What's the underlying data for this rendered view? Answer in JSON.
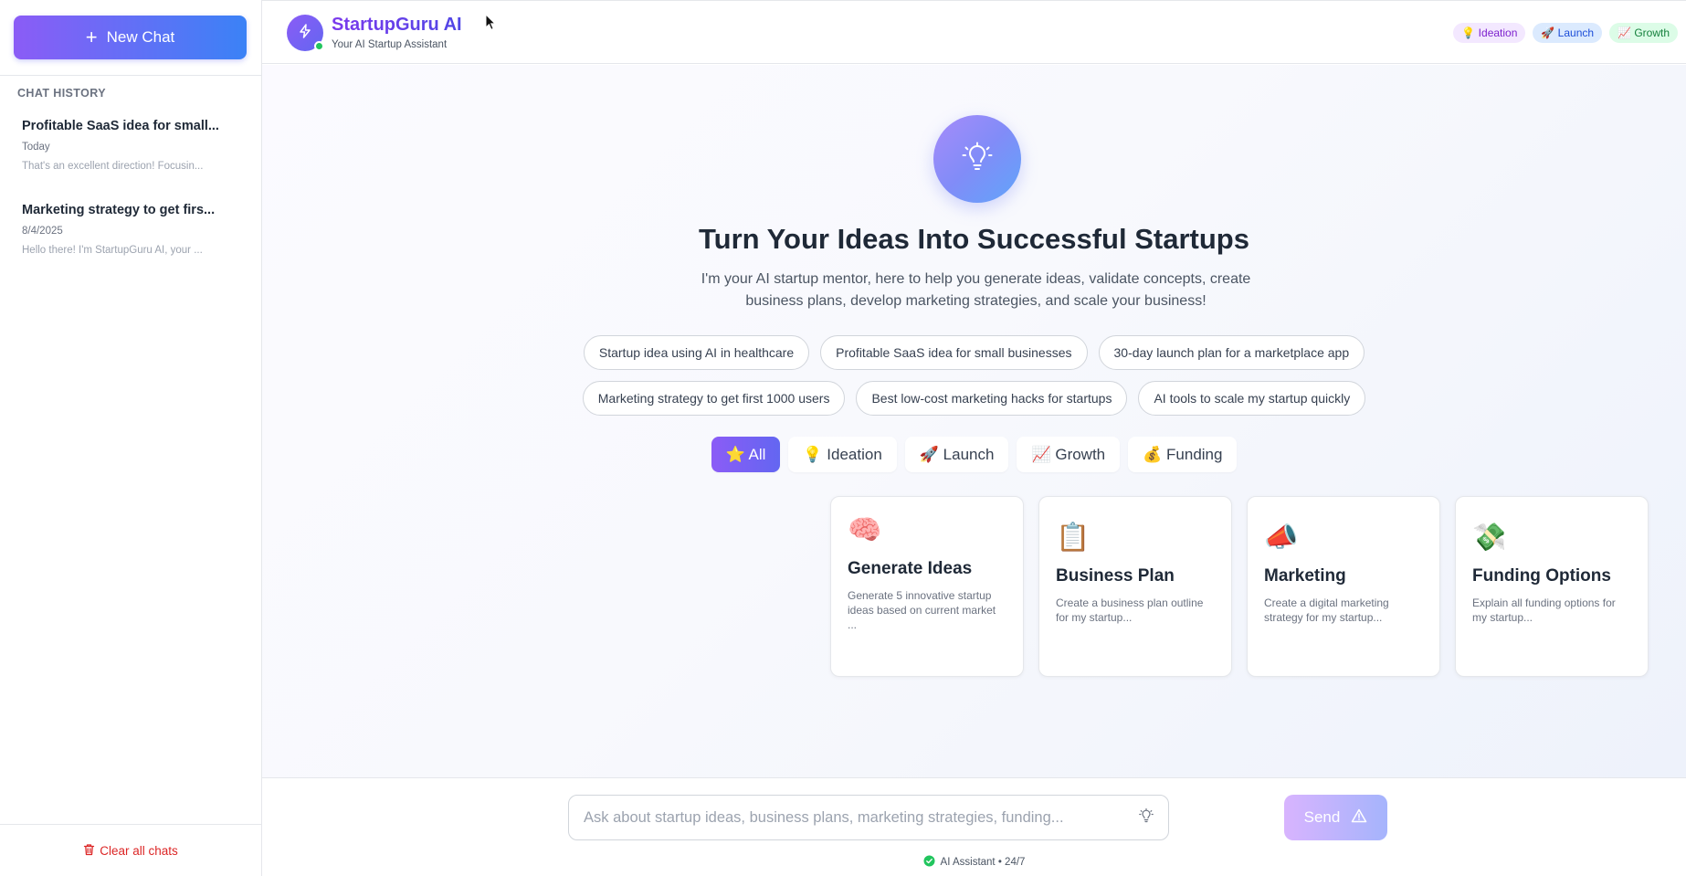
{
  "sidebar": {
    "new_chat_label": "New Chat",
    "history_title": "CHAT HISTORY",
    "history": [
      {
        "title": "Profitable SaaS idea for small...",
        "date": "Today",
        "preview": "That's an excellent direction! Focusin..."
      },
      {
        "title": "Marketing strategy to get firs...",
        "date": "8/4/2025",
        "preview": "Hello there! I'm StartupGuru AI, your ..."
      }
    ],
    "clear_label": "Clear all chats"
  },
  "header": {
    "app_name": "StartupGuru AI",
    "app_subtitle": "Your AI Startup Assistant",
    "tags": [
      "💡 Ideation",
      "🚀 Launch",
      "📈 Growth"
    ]
  },
  "hero": {
    "title": "Turn Your Ideas Into Successful Startups",
    "subtitle": "I'm your AI startup mentor, here to help you generate ideas, validate concepts, create business plans, develop marketing strategies, and scale your business!"
  },
  "prompts": [
    "Startup idea using AI in healthcare",
    "Profitable SaaS idea for small businesses",
    "30-day launch plan for a marketplace app",
    "Marketing strategy to get first 1000 users",
    "Best low-cost marketing hacks for startups",
    "AI tools to scale my startup quickly"
  ],
  "filters": [
    "⭐ All",
    "💡 Ideation",
    "🚀 Launch",
    "📈 Growth",
    "💰 Funding"
  ],
  "active_filter": "⭐ All",
  "cards": [
    {
      "icon": "🧠",
      "title": "Generate Ideas",
      "desc": "Generate 5 innovative startup ideas based on current market ..."
    },
    {
      "icon": "📋",
      "title": "Business Plan",
      "desc": "Create a business plan outline for my startup..."
    },
    {
      "icon": "📣",
      "title": "Marketing",
      "desc": "Create a digital marketing strategy for my startup..."
    },
    {
      "icon": "💸",
      "title": "Funding Options",
      "desc": "Explain all funding options for my startup..."
    }
  ],
  "input": {
    "placeholder": "Ask about startup ideas, business plans, marketing strategies, funding...",
    "value": "",
    "send_label": "Send",
    "status": "AI Assistant • 24/7"
  },
  "colors": {
    "accent_purple": "#8b5cf6",
    "accent_blue": "#3b82f6",
    "danger": "#dc2626",
    "online": "#22c55e"
  }
}
